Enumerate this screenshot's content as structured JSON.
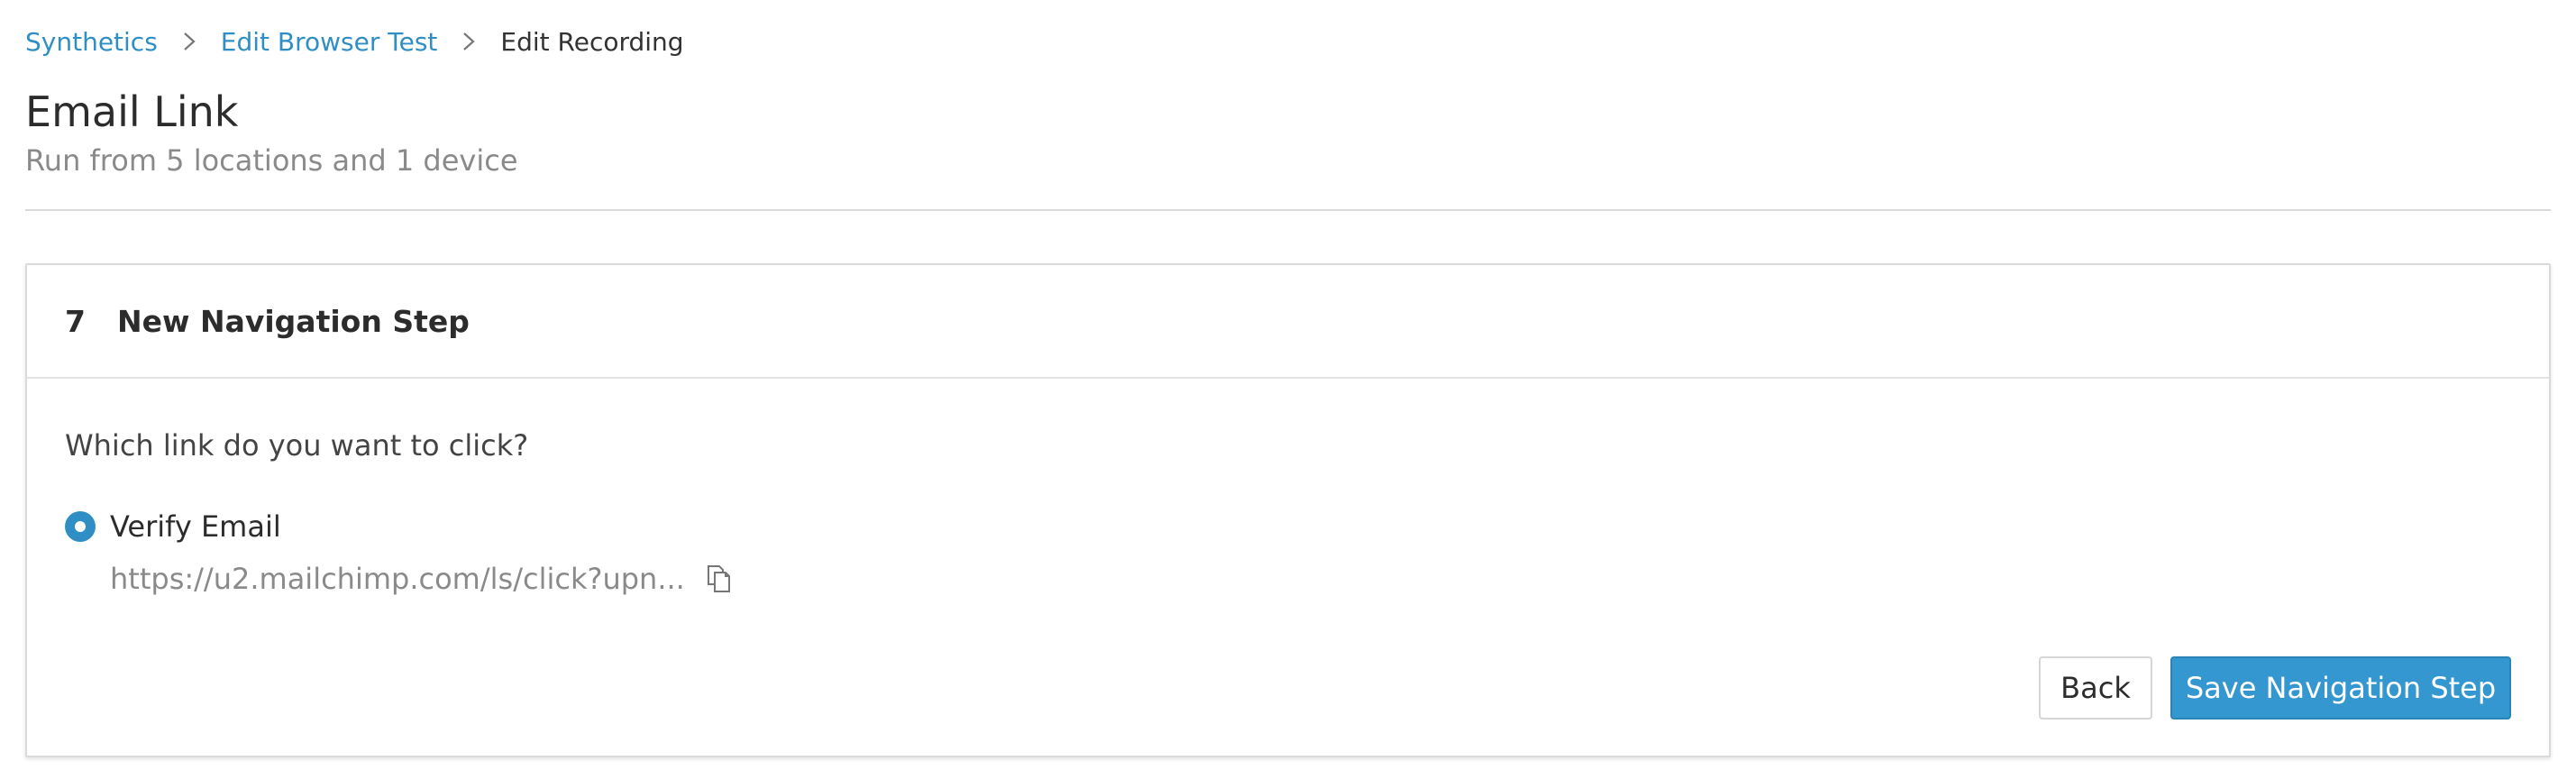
{
  "breadcrumb": {
    "items": [
      {
        "label": "Synthetics"
      },
      {
        "label": "Edit Browser Test"
      },
      {
        "label": "Edit Recording"
      }
    ]
  },
  "header": {
    "title": "Email Link",
    "subtitle": "Run from 5 locations and 1 device"
  },
  "step": {
    "number": "7",
    "title": "New Navigation Step",
    "question": "Which link do you want to click?",
    "option": {
      "label": "Verify Email",
      "url": "https://u2.mailchimp.com/ls/click?upn...",
      "selected": true
    }
  },
  "actions": {
    "back_label": "Back",
    "save_label": "Save Navigation Step"
  },
  "colors": {
    "accent": "#2f8fc4",
    "primary_button": "#3597cf"
  },
  "icons": {
    "separator": "chevron-right-icon",
    "copy": "copy-icon",
    "radio": "radio-selected-icon"
  }
}
